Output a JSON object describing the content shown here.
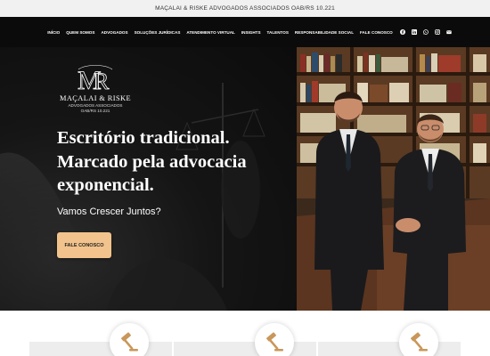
{
  "topbar": {
    "text": "MAÇALAI & RISKE ADVOGADOS ASSOCIADOS OAB/RS 10.221"
  },
  "nav": {
    "items": [
      "INÍCIO",
      "QUEM SOMOS",
      "ADVOGADOS",
      "SOLUÇÕES JURÍDICAS",
      "ATENDIMENTO VIRTUAL",
      "INSIGHTS",
      "TALENTOS",
      "RESPONSABILIDADE SOCIAL",
      "FALE CONOSCO"
    ],
    "social": [
      "facebook-icon",
      "linkedin-icon",
      "whatsapp-icon",
      "instagram-icon",
      "email-icon"
    ]
  },
  "logo": {
    "monogram": "MR",
    "name": "MAÇALAI & RISKE",
    "subtitle": "ADVOGADOS ASSOCIADOS",
    "registration": "OAB/RS 10.221"
  },
  "hero": {
    "headline": [
      "Escritório tradicional.",
      "Marcado pela advocacia",
      "exponencial."
    ],
    "subheadline": "Vamos Crescer Juntos?",
    "cta_label": "FALE CONOSCO"
  },
  "services": {
    "icons": [
      "gavel-icon",
      "gavel-icon",
      "gavel-icon"
    ]
  },
  "colors": {
    "accent": "#f2c38c",
    "dark": "#0b0b0b",
    "topbar": "#f1f1f1",
    "card": "#ededed",
    "icon": "#c9975a"
  }
}
